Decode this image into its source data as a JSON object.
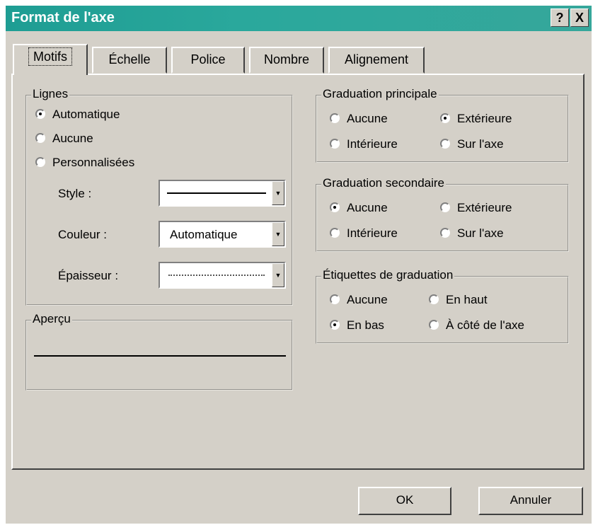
{
  "window": {
    "title": "Format de l'axe",
    "help_label": "?",
    "close_label": "X",
    "title_bar_color": "#1e9d93"
  },
  "tabs": [
    {
      "label": "Motifs",
      "active": true
    },
    {
      "label": "Échelle"
    },
    {
      "label": "Police"
    },
    {
      "label": "Nombre"
    },
    {
      "label": "Alignement"
    }
  ],
  "lignes": {
    "title": "Lignes",
    "options": [
      "Automatique",
      "Aucune",
      "Personnalisées"
    ],
    "selected": "Automatique",
    "style_label": "Style :",
    "couleur_label": "Couleur :",
    "couleur_value": "Automatique",
    "epaisseur_label": "Épaisseur :"
  },
  "apercu": {
    "title": "Aperçu"
  },
  "graduation_principale": {
    "title": "Graduation principale",
    "options": [
      "Aucune",
      "Extérieure",
      "Intérieure",
      "Sur l'axe"
    ],
    "selected": "Extérieure"
  },
  "graduation_secondaire": {
    "title": "Graduation secondaire",
    "options": [
      "Aucune",
      "Extérieure",
      "Intérieure",
      "Sur l'axe"
    ],
    "selected": "Aucune"
  },
  "etiquettes": {
    "title": "Étiquettes de graduation",
    "options": [
      "Aucune",
      "En haut",
      "En bas",
      "À côté de l'axe"
    ],
    "selected": "En bas"
  },
  "buttons": {
    "ok": "OK",
    "cancel": "Annuler"
  }
}
